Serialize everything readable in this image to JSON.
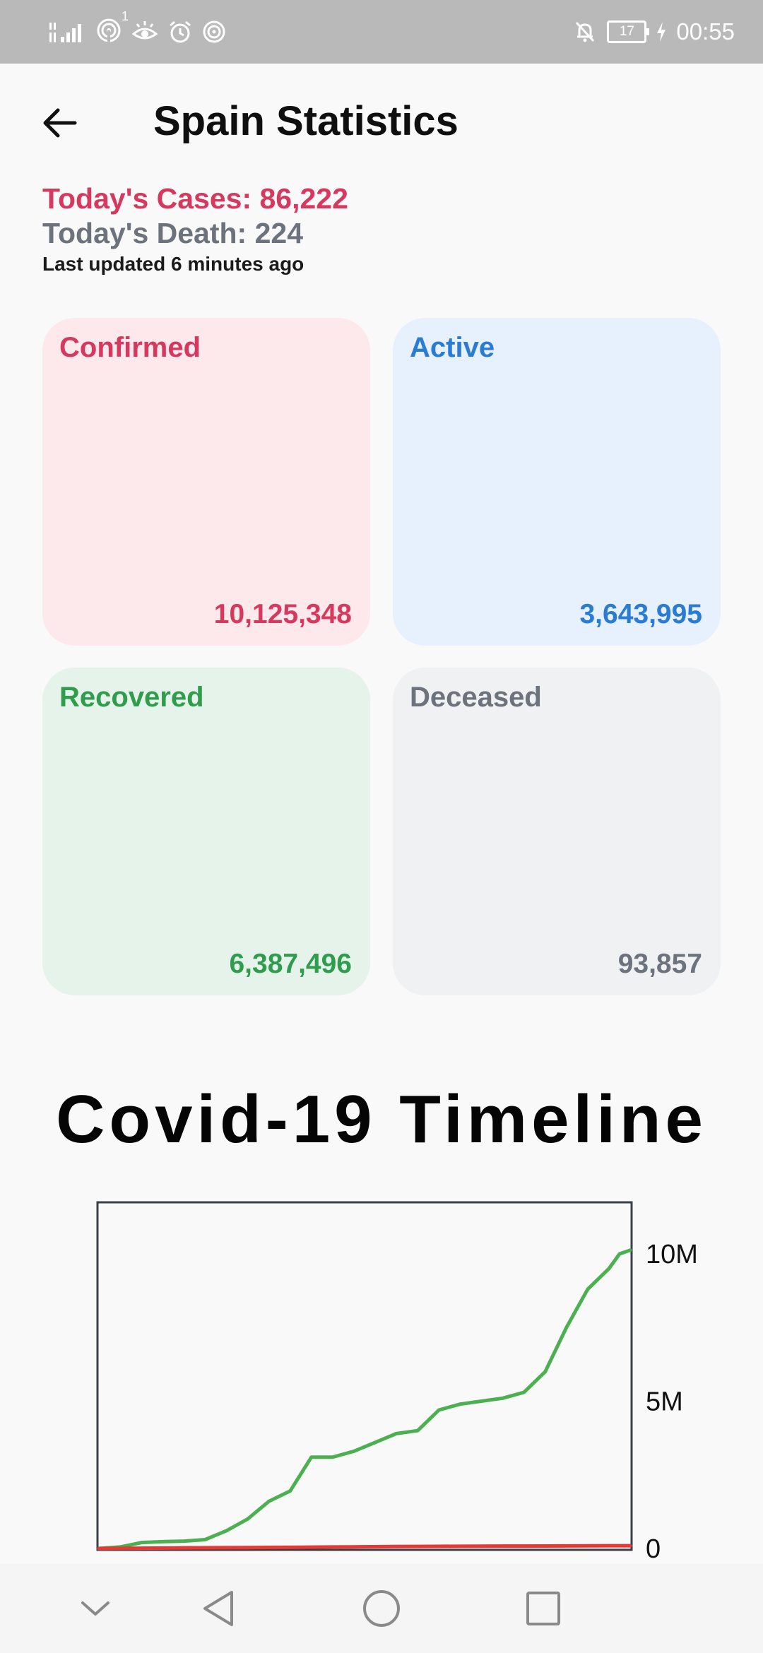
{
  "status_bar": {
    "signal_icons": [
      "signal-bars-icon",
      "hotspot-icon",
      "eye-comfort-icon",
      "alarm-icon",
      "nfc-icon"
    ],
    "hotspot_count": "1",
    "battery_level": "17",
    "time": "00:55"
  },
  "header": {
    "title": "Spain Statistics",
    "back_icon": "arrow-left-icon"
  },
  "today": {
    "cases": "Today's Cases: 86,222",
    "death": "Today's Death: 224",
    "last_updated": "Last updated 6 minutes ago"
  },
  "cards": {
    "confirmed": {
      "label": "Confirmed",
      "value": "10,125,348",
      "color": "#d7385e",
      "bg": "#fde8ec"
    },
    "active": {
      "label": "Active",
      "value": "3,643,995",
      "color": "#2a7bd4",
      "bg": "#e6f1fd"
    },
    "recovered": {
      "label": "Recovered",
      "value": "6,387,496",
      "color": "#2f9c4e",
      "bg": "#e6f3ea"
    },
    "deceased": {
      "label": "Deceased",
      "value": "93,857",
      "color": "#6c737c",
      "bg": "#f0f1f2"
    }
  },
  "timeline": {
    "title": "Covid-19 Timeline"
  },
  "chart_data": {
    "type": "line",
    "title": "",
    "xlabel": "",
    "ylabel": "",
    "ylim": [
      0,
      12000000
    ],
    "ytick_labels": [
      "0",
      "5M",
      "10M"
    ],
    "ytick_values": [
      0,
      5000000,
      10000000
    ],
    "grid": false,
    "x": [
      0,
      4,
      8,
      12,
      16,
      20,
      24,
      28,
      32,
      36,
      40,
      44,
      48,
      52,
      56,
      60,
      64,
      68,
      72,
      76,
      80,
      84,
      88,
      92,
      96,
      98,
      100
    ],
    "series": [
      {
        "color": "#4caf50",
        "values": [
          0,
          50000,
          200000,
          230000,
          250000,
          300000,
          600000,
          1000000,
          1600000,
          1950000,
          3100000,
          3100000,
          3300000,
          3600000,
          3900000,
          4000000,
          4700000,
          4900000,
          5000000,
          5100000,
          5300000,
          6000000,
          7500000,
          8800000,
          9500000,
          10000000,
          10125348
        ]
      },
      {
        "color": "#e53935",
        "values": [
          0,
          5000,
          10000,
          15000,
          20000,
          25000,
          28000,
          30000,
          35000,
          40000,
          45000,
          50000,
          55000,
          60000,
          65000,
          70000,
          72000,
          75000,
          78000,
          80000,
          82000,
          85000,
          88000,
          90000,
          92000,
          93000,
          93857
        ]
      }
    ]
  },
  "nav_bar": {
    "icons": [
      "chevron-down-icon",
      "back-triangle-icon",
      "home-circle-icon",
      "recents-square-icon"
    ]
  }
}
